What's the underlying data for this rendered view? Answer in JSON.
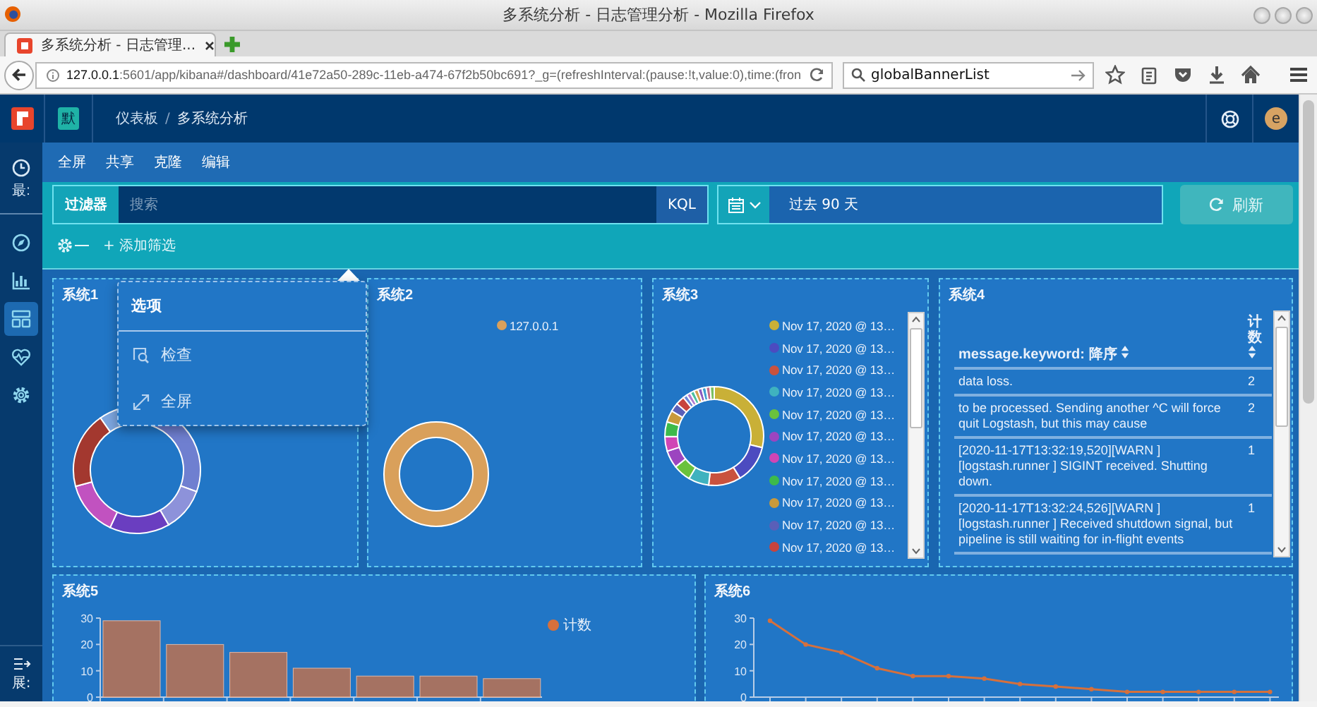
{
  "window": {
    "title": "多系统分析 - 日志管理分析 - Mozilla Firefox"
  },
  "browser_tabs": [
    {
      "label": "多系统分析 - 日志管理...",
      "selected": true
    }
  ],
  "address_bar": {
    "host": "127.0.0.1",
    "path": ":5601/app/kibana#/dashboard/41e72a50-289c-11eb-a474-67f2b50bc691?_g=(refreshInterval:(pause:!t,value:0),time:(fron"
  },
  "search_bar": {
    "value": "globalBannerList"
  },
  "header": {
    "space_badge": "默",
    "breadcrumbs": [
      "仪表板",
      "多系统分析"
    ],
    "breadcrumb_separator": "/",
    "avatar": "e"
  },
  "sidebar": {
    "items": [
      {
        "kind": "recent",
        "label": "最:",
        "selected": false
      },
      {
        "kind": "discover",
        "selected": false
      },
      {
        "kind": "visualize",
        "selected": false
      },
      {
        "kind": "dashboard",
        "selected": true
      },
      {
        "kind": "monitoring",
        "selected": false
      },
      {
        "kind": "management",
        "selected": false
      }
    ],
    "collapse_label": "展:"
  },
  "top_menu": [
    "全屏",
    "共享",
    "克隆",
    "编辑"
  ],
  "query_bar": {
    "label": "过滤器",
    "placeholder": "搜索",
    "language": "KQL",
    "time_range": "过去 90 天",
    "refresh": "刷新",
    "add_filter": "+ 添加筛选"
  },
  "panels": [
    {
      "kind": "donut",
      "title": "系统1",
      "menu_open": true
    },
    {
      "kind": "donut",
      "title": "系统2",
      "menu_open": false,
      "legend": [
        {
          "label": "127.0.0.1",
          "color": "#d9a05b"
        }
      ]
    },
    {
      "kind": "donut",
      "title": "系统3",
      "menu_open": false,
      "legend": [
        {
          "label": "Nov 17, 2020 @ 13…",
          "color": "#c9b037"
        },
        {
          "label": "Nov 17, 2020 @ 13…",
          "color": "#4c4bc0"
        },
        {
          "label": "Nov 17, 2020 @ 13…",
          "color": "#c9523e"
        },
        {
          "label": "Nov 17, 2020 @ 13…",
          "color": "#3fb2bf"
        },
        {
          "label": "Nov 17, 2020 @ 13…",
          "color": "#6ac23c"
        },
        {
          "label": "Nov 17, 2020 @ 13…",
          "color": "#9c45c0"
        },
        {
          "label": "Nov 17, 2020 @ 13…",
          "color": "#d045b5"
        },
        {
          "label": "Nov 17, 2020 @ 13…",
          "color": "#3dba4a"
        },
        {
          "label": "Nov 17, 2020 @ 13…",
          "color": "#c99a3b"
        },
        {
          "label": "Nov 17, 2020 @ 13…",
          "color": "#5a5fb8"
        },
        {
          "label": "Nov 17, 2020 @ 13…",
          "color": "#c8433d"
        }
      ]
    },
    {
      "kind": "table",
      "title": "系统4",
      "menu_open": false,
      "columns": [
        "message.keyword: 降序",
        "计数"
      ],
      "rows": [
        [
          "data loss.",
          "2"
        ],
        [
          "to be processed. Sending another ^C will force quit Logstash, but this may cause",
          "2"
        ],
        [
          "[2020-11-17T13:32:19,520][WARN ][logstash.runner ] SIGINT received. Shutting down.",
          "1"
        ],
        [
          "[2020-11-17T13:32:24,526][WARN ][logstash.runner ] Received shutdown signal, but pipeline is still waiting for in-flight events",
          "1"
        ]
      ]
    },
    {
      "kind": "bar",
      "title": "系统5",
      "menu_open": false,
      "chart_data": {
        "type": "bar",
        "series": [
          {
            "name": "计数",
            "color": "#d6703c",
            "values": [
              29,
              20,
              17,
              11,
              8,
              8,
              7
            ]
          }
        ],
        "ylim": [
          0,
          30
        ],
        "yticks": [
          0,
          10,
          20,
          30
        ]
      }
    },
    {
      "kind": "line",
      "title": "系统6",
      "menu_open": false,
      "chart_data": {
        "type": "line",
        "series": [
          {
            "color": "#d6703c",
            "marker": true,
            "values": [
              29,
              20,
              17,
              11,
              8,
              8,
              7,
              5,
              4,
              3,
              2,
              2,
              2,
              2,
              2
            ]
          }
        ],
        "ylim": [
          0,
          30
        ],
        "yticks": [
          0,
          10,
          20,
          30
        ]
      }
    }
  ],
  "panel_menu": {
    "title": "选项",
    "items": [
      {
        "kind": "inspect",
        "label": "检查"
      },
      {
        "kind": "fullscreen",
        "label": "全屏"
      }
    ]
  }
}
